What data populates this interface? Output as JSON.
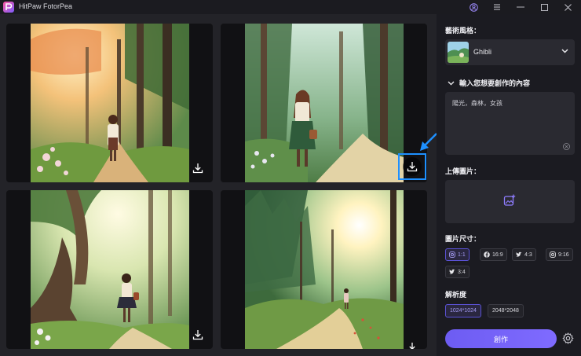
{
  "window": {
    "title": "HitPaw FotorPea"
  },
  "gallery": {
    "images": [
      {
        "id": "image-1",
        "theme": "forest-sunlight-flowers"
      },
      {
        "id": "image-2",
        "theme": "forest-path-girl-bag"
      },
      {
        "id": "image-3",
        "theme": "big-tree-girl"
      },
      {
        "id": "image-4",
        "theme": "forest-sunburst-path"
      }
    ]
  },
  "panel": {
    "art_style_label": "藝術風格：",
    "style_name": "Ghibli",
    "prompt_label": "輸入您想要創作的內容",
    "prompt_value": "陽光，森林，女孩",
    "upload_label": "上傳圖片：",
    "size_label": "圖片尺寸：",
    "ratios": [
      {
        "label": "1:1",
        "icon": "instagram-icon",
        "active": true
      },
      {
        "label": "16:9",
        "icon": "facebook-icon",
        "active": false
      },
      {
        "label": "4:3",
        "icon": "twitter-icon",
        "active": false
      },
      {
        "label": "9:16",
        "icon": "instagram-icon",
        "active": false
      },
      {
        "label": "3:4",
        "icon": "twitter-icon",
        "active": false
      }
    ],
    "resolution_label": "解析度",
    "resolutions": [
      {
        "label": "1024*1024",
        "active": true
      },
      {
        "label": "2048*2048",
        "active": false
      }
    ],
    "create_label": "創作"
  },
  "colors": {
    "accent": "#6d5cf2",
    "highlight": "#1e90ff",
    "panel_bg": "#1b1b21",
    "gallery_bg": "#232328"
  }
}
